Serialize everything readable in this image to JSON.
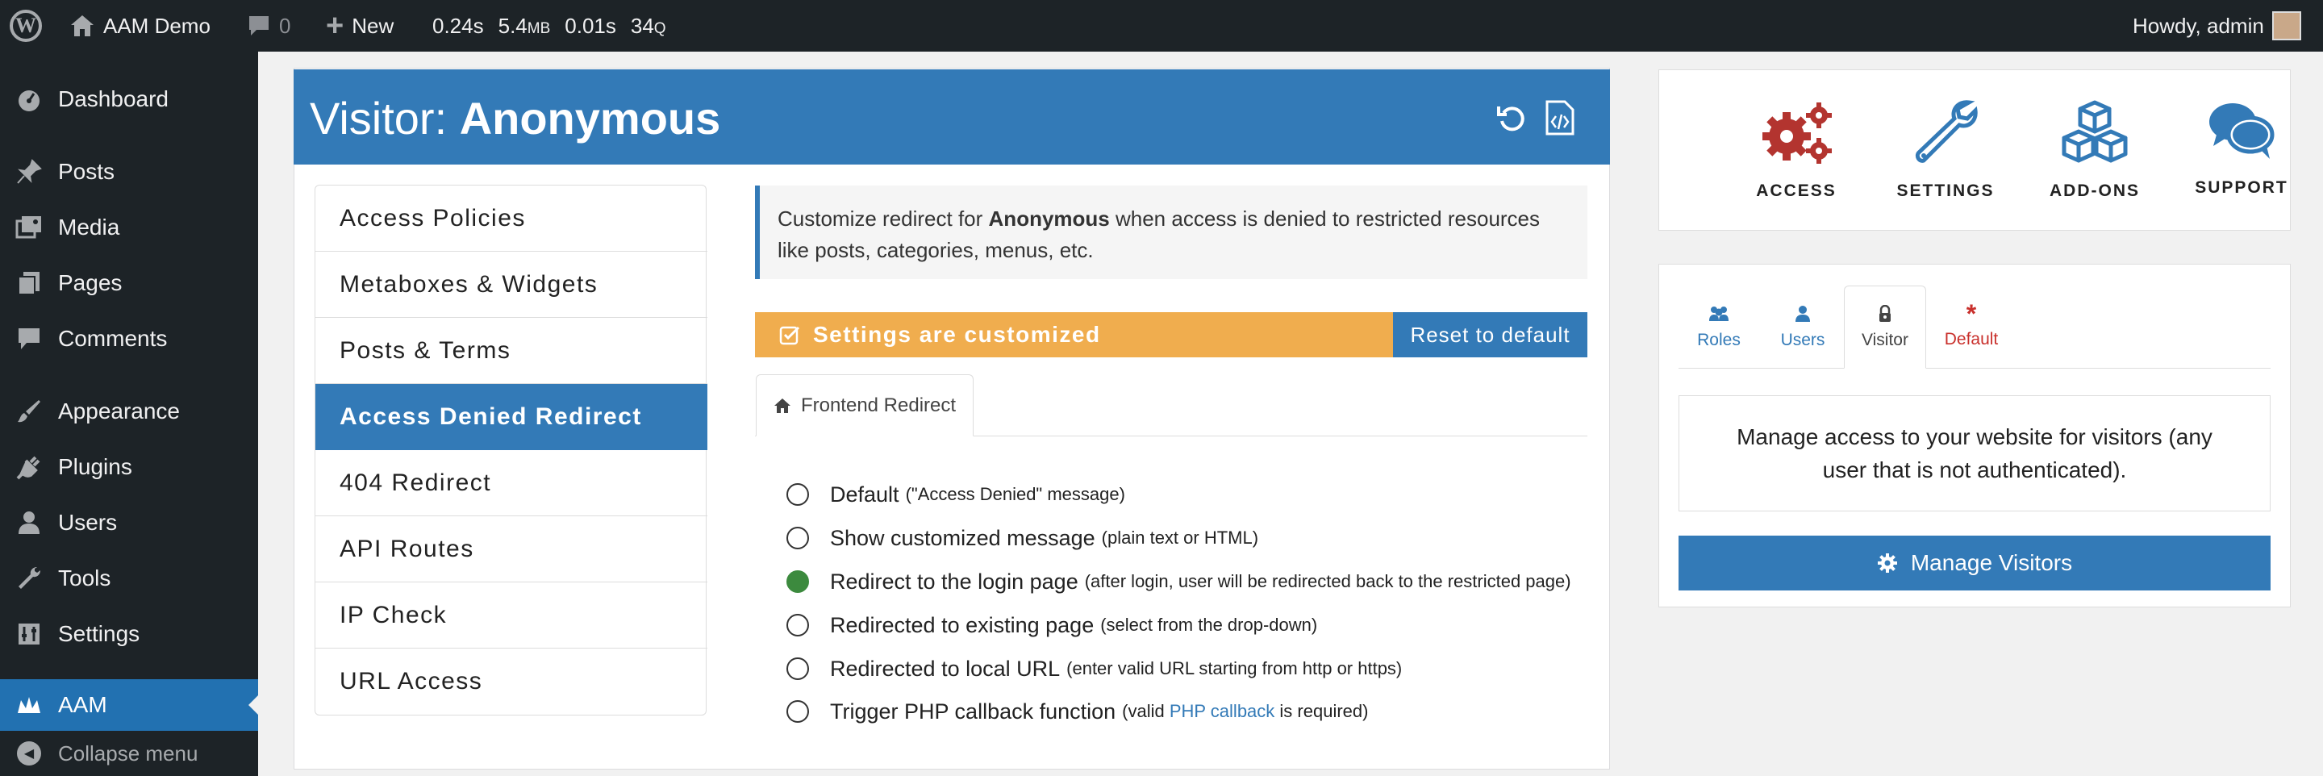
{
  "admin_bar": {
    "site_name": "AAM Demo",
    "comments_count": "0",
    "new_label": "New",
    "metrics": [
      "0.24s",
      "5.4",
      "MB",
      "0.01s",
      "34",
      "Q"
    ],
    "howdy": "Howdy, admin"
  },
  "sidebar": {
    "items": [
      {
        "label": "Dashboard",
        "icon": "dashboard-icon"
      },
      {
        "label": "Posts",
        "icon": "pin-icon"
      },
      {
        "label": "Media",
        "icon": "media-icon"
      },
      {
        "label": "Pages",
        "icon": "pages-icon"
      },
      {
        "label": "Comments",
        "icon": "comments-icon"
      },
      {
        "label": "Appearance",
        "icon": "brush-icon"
      },
      {
        "label": "Plugins",
        "icon": "plug-icon"
      },
      {
        "label": "Users",
        "icon": "user-icon"
      },
      {
        "label": "Tools",
        "icon": "wrench-icon"
      },
      {
        "label": "Settings",
        "icon": "settings-icon"
      },
      {
        "label": "AAM",
        "icon": "aam-icon"
      }
    ],
    "collapse_label": "Collapse menu"
  },
  "header": {
    "prefix": "Visitor: ",
    "subject": "Anonymous"
  },
  "left_menu": [
    "Access Policies",
    "Metaboxes & Widgets",
    "Posts & Terms",
    "Access Denied Redirect",
    "404 Redirect",
    "API Routes",
    "IP Check",
    "URL Access"
  ],
  "info": {
    "before": "Customize redirect for ",
    "subject": "Anonymous",
    "after": " when access is denied to restricted resources like posts, categories, menus, etc."
  },
  "banner": {
    "text": "Settings are customized",
    "reset_label": "Reset to default"
  },
  "tab": {
    "label": "Frontend Redirect"
  },
  "options": [
    {
      "label": "Default",
      "note": "(\"Access Denied\" message)",
      "checked": false
    },
    {
      "label": "Show customized message",
      "note": "(plain text or HTML)",
      "checked": false
    },
    {
      "label": "Redirect to the login page",
      "note": "(after login, user will be redirected back to the restricted page)",
      "checked": true
    },
    {
      "label": "Redirected to existing page",
      "note": "(select from the drop-down)",
      "checked": false
    },
    {
      "label": "Redirected to local URL",
      "note": "(enter valid URL starting from http or https)",
      "checked": false
    },
    {
      "label": "Trigger PHP callback function",
      "note_before": "(valid ",
      "note_link": "PHP callback",
      "note_after": " is required)",
      "checked": false
    }
  ],
  "right_top": [
    {
      "label": "ACCESS",
      "icon": "gears-icon"
    },
    {
      "label": "SETTINGS",
      "icon": "wrench-icon"
    },
    {
      "label": "ADD-ONS",
      "icon": "cubes-icon"
    },
    {
      "label": "SUPPORT",
      "icon": "chat-bubbles-icon"
    }
  ],
  "subject_tabs": [
    {
      "label": "Roles",
      "icon": "users-icon"
    },
    {
      "label": "Users",
      "icon": "user-icon"
    },
    {
      "label": "Visitor",
      "icon": "lock-icon"
    },
    {
      "label": "Default",
      "icon": "asterisk-icon"
    }
  ],
  "visitor_panel": {
    "description": "Manage access to your website for visitors (any user that is not authenticated).",
    "button_label": "Manage Visitors"
  },
  "colors": {
    "admin_dark": "#1d2327",
    "wp_blue": "#2271b1",
    "aam_blue": "#337ab7",
    "warning_orange": "#f0ad4e",
    "radio_green": "#3c8a3e",
    "accent_red": "#b3342f"
  }
}
